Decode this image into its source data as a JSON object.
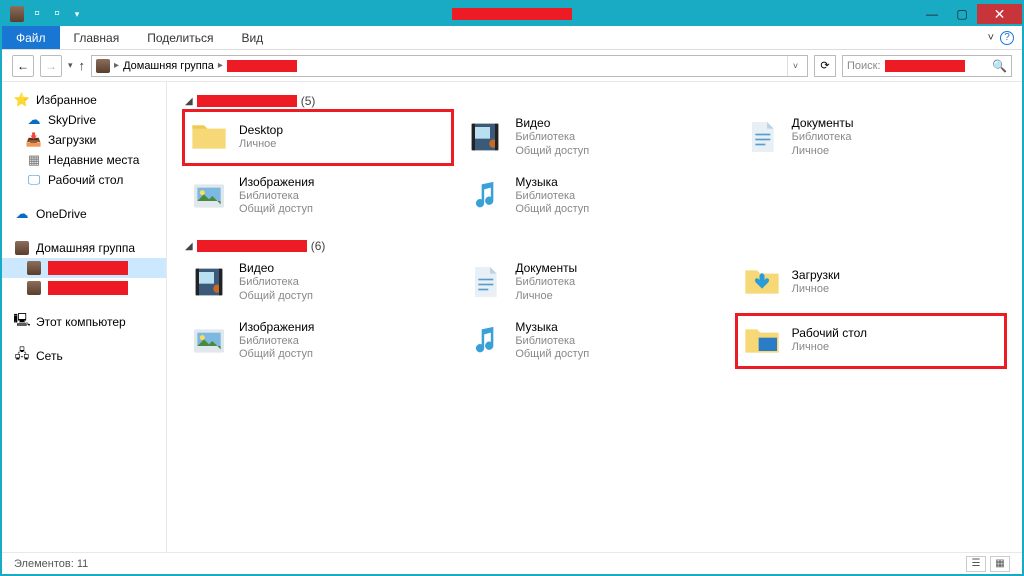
{
  "ribbon": {
    "file": "Файл",
    "home": "Главная",
    "share": "Поделиться",
    "view": "Вид"
  },
  "breadcrumb": {
    "seg1": "Домашняя группа",
    "seg2_redacted": true
  },
  "search": {
    "label": "Поиск:"
  },
  "sidebar": {
    "favorites": "Избранное",
    "skydrive": "SkyDrive",
    "downloads": "Загрузки",
    "recent": "Недавние места",
    "desktop": "Рабочий стол",
    "onedrive": "OneDrive",
    "homegroup": "Домашняя группа",
    "thispc": "Этот компьютер",
    "network": "Сеть"
  },
  "groups": [
    {
      "count": "(5)",
      "items": [
        {
          "name": "Desktop",
          "l2": "Личное",
          "icon": "folder",
          "hl": true
        },
        {
          "name": "Видео",
          "l2": "Библиотека",
          "l3": "Общий доступ",
          "icon": "video"
        },
        {
          "name": "Документы",
          "l2": "Библиотека",
          "l3": "Личное",
          "icon": "doc"
        },
        {
          "name": "Изображения",
          "l2": "Библиотека",
          "l3": "Общий доступ",
          "icon": "image"
        },
        {
          "name": "Музыка",
          "l2": "Библиотека",
          "l3": "Общий доступ",
          "icon": "music"
        }
      ]
    },
    {
      "count": "(6)",
      "items": [
        {
          "name": "Видео",
          "l2": "Библиотека",
          "l3": "Общий доступ",
          "icon": "video"
        },
        {
          "name": "Документы",
          "l2": "Библиотека",
          "l3": "Личное",
          "icon": "doc"
        },
        {
          "name": "Загрузки",
          "l2": "Личное",
          "icon": "download"
        },
        {
          "name": "Изображения",
          "l2": "Библиотека",
          "l3": "Общий доступ",
          "icon": "image"
        },
        {
          "name": "Музыка",
          "l2": "Библиотека",
          "l3": "Общий доступ",
          "icon": "music"
        },
        {
          "name": "Рабочий стол",
          "l2": "Личное",
          "icon": "folder-blue",
          "hl": true
        }
      ]
    }
  ],
  "status": {
    "items": "Элементов: 11"
  }
}
